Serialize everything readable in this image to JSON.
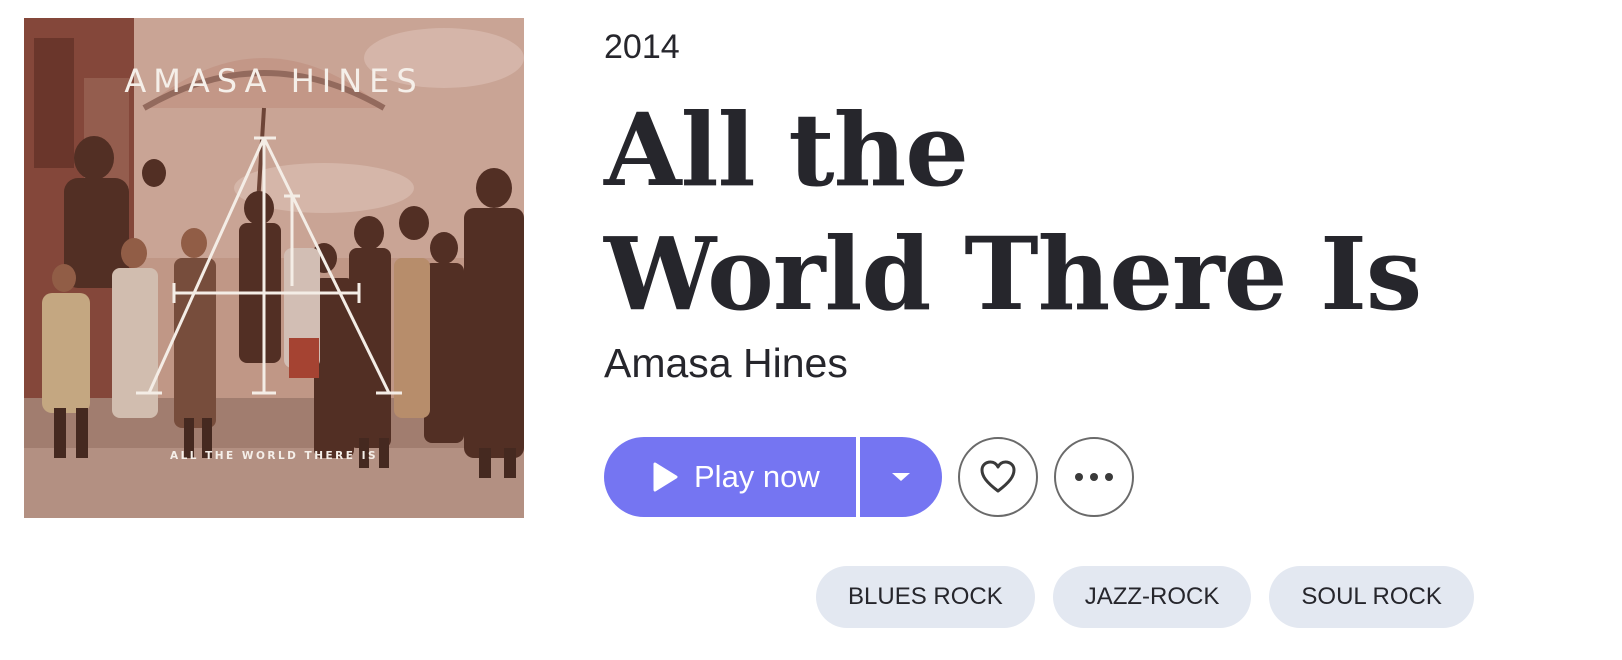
{
  "album": {
    "year": "2014",
    "title_line1": "All the",
    "title_line2": "World There Is",
    "artist": "Amasa Hines"
  },
  "cover": {
    "artist_text": "AMASA HINES",
    "album_text": "ALL THE WORLD THERE IS"
  },
  "actions": {
    "play_label": "Play now",
    "accent_color": "#7575f2"
  },
  "genres": [
    "BLUES ROCK",
    "JAZZ-ROCK",
    "SOUL ROCK"
  ],
  "icons": {
    "play": "play-icon",
    "dropdown": "caret-down-icon",
    "favorite": "heart-icon",
    "more": "more-dots-icon"
  }
}
